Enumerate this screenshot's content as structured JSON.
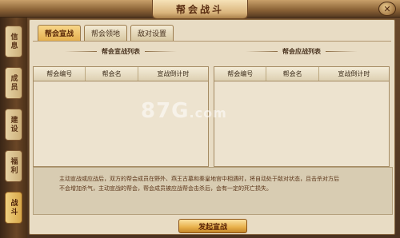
{
  "window": {
    "title": "帮会战斗",
    "close_label": "✕"
  },
  "side_tabs": [
    {
      "label": "信息",
      "active": false
    },
    {
      "label": "成员",
      "active": false
    },
    {
      "label": "建设",
      "active": false
    },
    {
      "label": "福利",
      "active": false
    },
    {
      "label": "战斗",
      "active": true
    }
  ],
  "tabs": [
    {
      "label": "帮会宣战",
      "active": true
    },
    {
      "label": "帮会领地",
      "active": false
    },
    {
      "label": "敌对设置",
      "active": false
    }
  ],
  "declare_list": {
    "title": "帮会宣战列表",
    "headers": [
      "帮会编号",
      "帮会名",
      "宣战倒计时"
    ],
    "rows": []
  },
  "respond_list": {
    "title": "帮会应战列表",
    "headers": [
      "帮会编号",
      "帮会名",
      "宣战倒计时"
    ],
    "rows": []
  },
  "notice": {
    "line1": "主动宣战或应战后，双方的帮会成员在野外、燕王古墓和秦皇地宫中相遇时，将自动处于敌对状态，且击杀对方后",
    "line2": "不会增加杀气，主动宣战的帮会，帮会成员被应战帮会击杀后，会有一定的死亡损失。"
  },
  "action": {
    "label": "发起宣战"
  },
  "watermark": {
    "text": "87G",
    "suffix": ".com"
  }
}
